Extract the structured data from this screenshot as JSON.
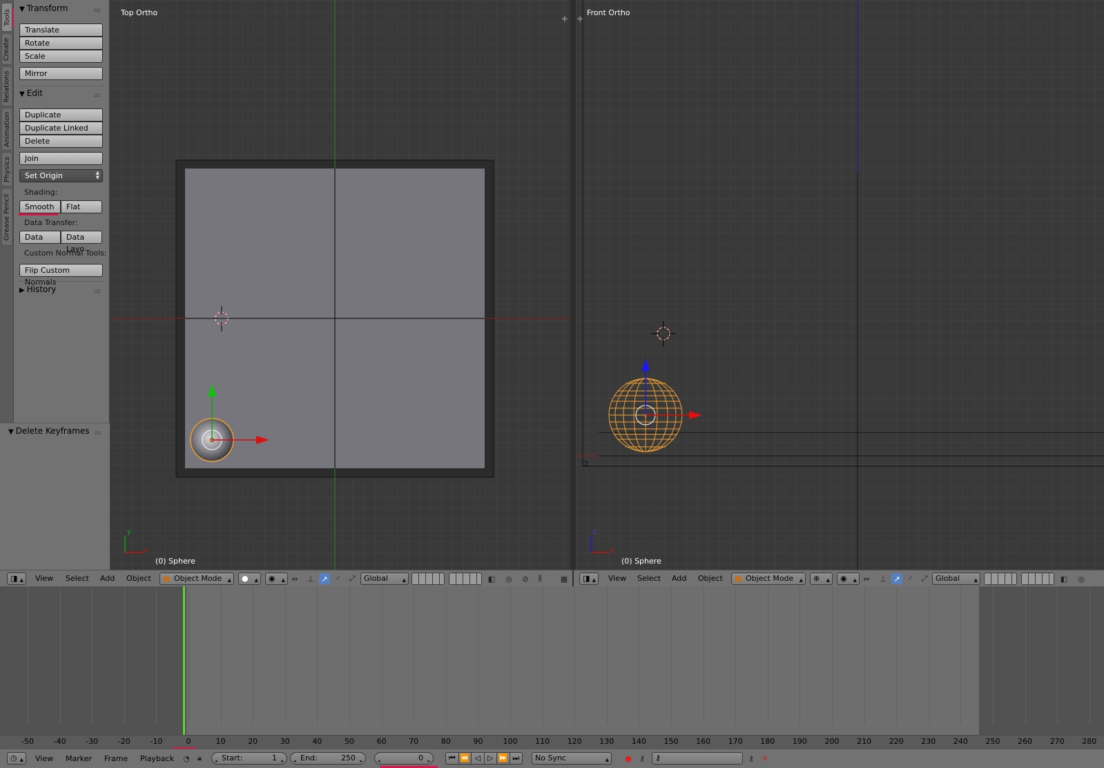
{
  "tool_tabs": [
    "Tools",
    "Create",
    "Relations",
    "Animation",
    "Physics",
    "Grease Pencil"
  ],
  "toolshelf": {
    "transform_title": "Transform",
    "translate": "Translate",
    "rotate": "Rotate",
    "scale": "Scale",
    "mirror": "Mirror",
    "edit_title": "Edit",
    "duplicate": "Duplicate",
    "duplicate_linked": "Duplicate Linked",
    "delete": "Delete",
    "join": "Join",
    "set_origin": "Set Origin",
    "shading_label": "Shading:",
    "smooth": "Smooth",
    "flat": "Flat",
    "data_transfer_label": "Data Transfer:",
    "data": "Data",
    "data_layo": "Data Layo",
    "custom_normal_label": "Custom Normal Tools:",
    "flip_custom_normals": "Flip Custom Normals",
    "history_title": "History",
    "delete_keyframes_title": "Delete Keyframes"
  },
  "viewport_left": {
    "title": "Top Ortho",
    "object": "(0) Sphere",
    "axis_y": "y",
    "axis_x": "x"
  },
  "viewport_right": {
    "title": "Front Ortho",
    "object": "(0) Sphere",
    "axis_z": "z",
    "axis_x": "x"
  },
  "header_left": {
    "view": "View",
    "select": "Select",
    "add": "Add",
    "object": "Object",
    "mode": "Object Mode",
    "orientation": "Global"
  },
  "header_right": {
    "view": "View",
    "select": "Select",
    "add": "Add",
    "object": "Object",
    "mode": "Object Mode",
    "orientation": "Global"
  },
  "timeline": {
    "ruler": [
      "-50",
      "-40",
      "-30",
      "-20",
      "-10",
      "0",
      "10",
      "20",
      "30",
      "40",
      "50",
      "60",
      "70",
      "80",
      "90",
      "100",
      "110",
      "120",
      "130",
      "140",
      "150",
      "160",
      "170",
      "180",
      "190",
      "200",
      "210",
      "220",
      "230",
      "240",
      "250",
      "260",
      "270",
      "280"
    ],
    "view": "View",
    "marker": "Marker",
    "frame": "Frame",
    "playback": "Playback",
    "start_label": "Start:",
    "start_value": "1",
    "end_label": "End:",
    "end_value": "250",
    "current_frame": "0",
    "sync": "No Sync"
  },
  "colors": {
    "accent_red": "#d8174a",
    "axis_x": "#cc1010",
    "axis_y": "#11a311",
    "axis_z": "#1a1ae0",
    "selected_orange": "#f0a030",
    "playhead_green": "#5fd33a",
    "active_icon_blue": "#5680c2"
  }
}
